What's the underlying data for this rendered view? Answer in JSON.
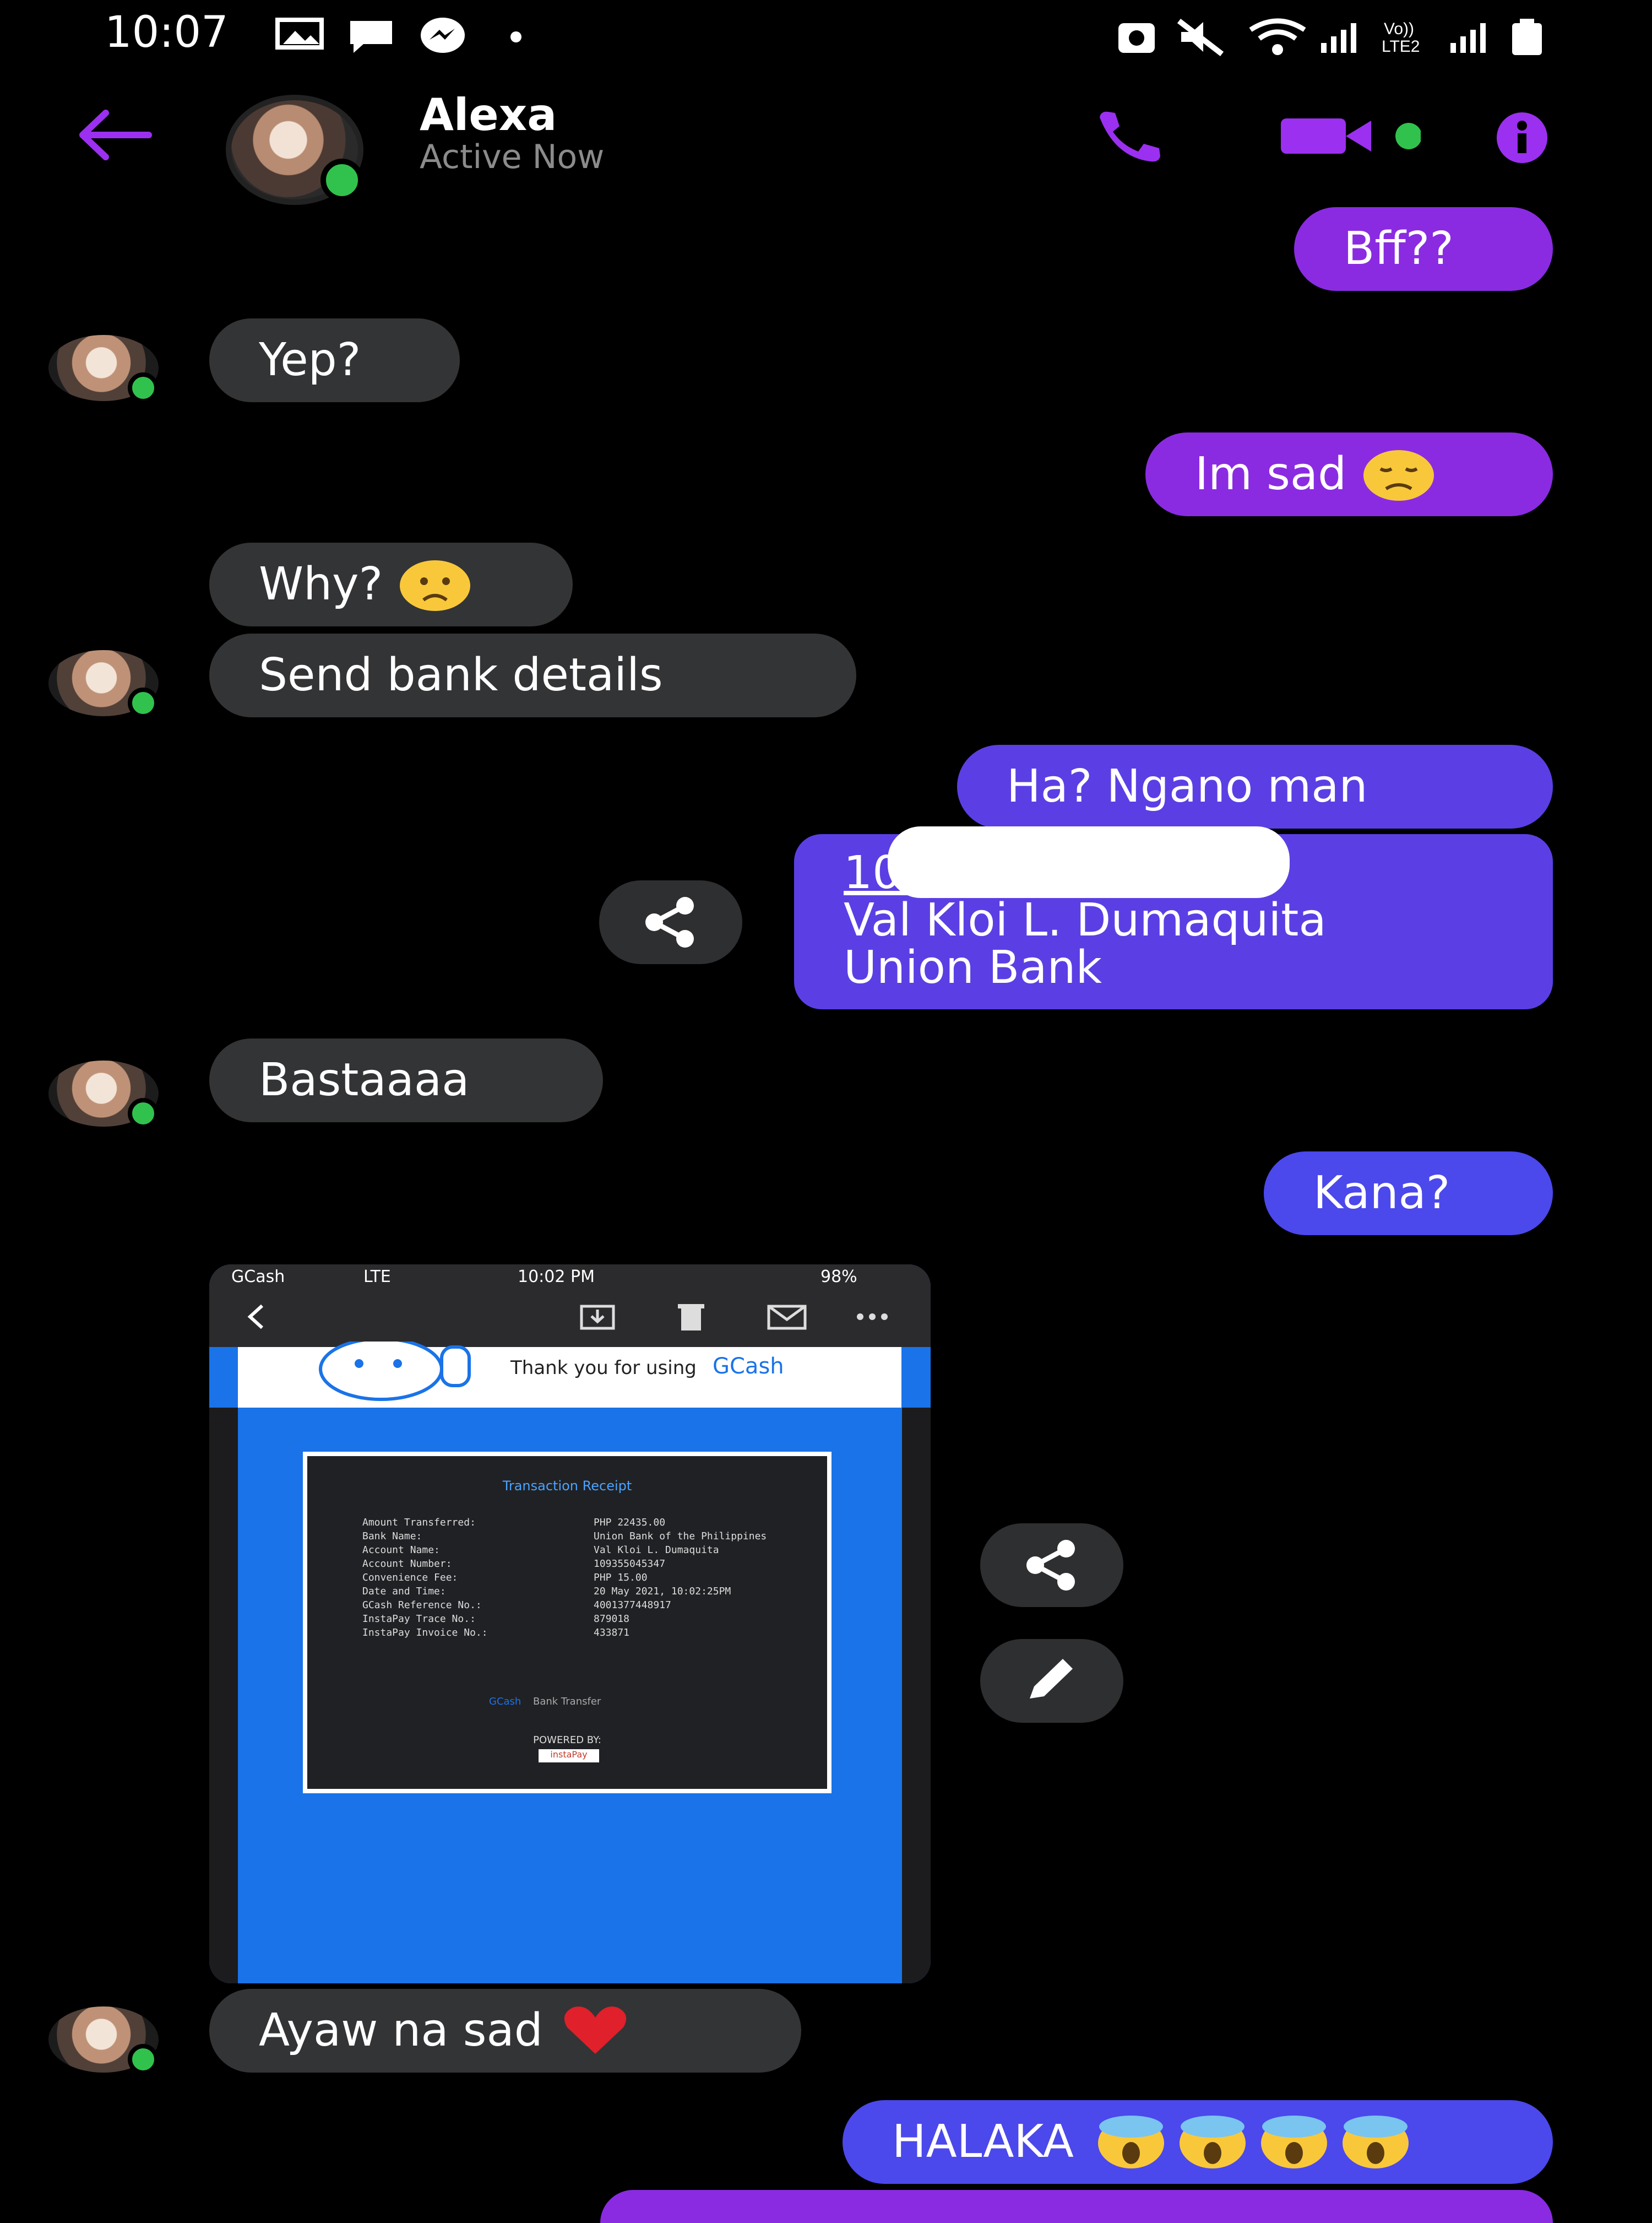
{
  "status_bar": {
    "time": "10:07"
  },
  "header": {
    "contact_name": "Alexa",
    "presence": "Active Now"
  },
  "messages": {
    "m1": "Bff??",
    "m2": "Yep?",
    "m3": "Im sad",
    "m4": "Why?",
    "m5": "Send bank details",
    "m6": "Ha? Ngano man",
    "m7_line1": "10          7",
    "m7_line2": "Val Kloi L. Dumaquita",
    "m7_line3": "Union Bank",
    "m8": "Bastaaaa",
    "m9": "Kana?",
    "m10": "Ayaw na sad",
    "m11": "HALAKA"
  },
  "receipt_image": {
    "status_left": "GCash",
    "status_network": "LTE",
    "status_time": "10:02 PM",
    "status_battery": "98%",
    "thank_text": "Thank you for using",
    "brand": "GCash",
    "title": "Transaction Receipt",
    "rows": [
      {
        "label": "Amount Transferred:",
        "value": "PHP 22435.00"
      },
      {
        "label": "Bank Name:",
        "value": "Union Bank of the Philippines"
      },
      {
        "label": "Account Name:",
        "value": "Val Kloi L. Dumaquita"
      },
      {
        "label": "Account Number:",
        "value": "109355045347"
      },
      {
        "label": "Convenience Fee:",
        "value": "PHP 15.00"
      },
      {
        "label": "Date and Time:",
        "value": "20 May 2021, 10:02:25PM"
      },
      {
        "label": "GCash Reference No.:",
        "value": "4001377448917"
      },
      {
        "label": "InstaPay Trace No.:",
        "value": "879018"
      },
      {
        "label": "InstaPay Invoice No.:",
        "value": "433871"
      }
    ],
    "footer_brand": "GCash",
    "footer_label": "Bank Transfer",
    "powered_by": "POWERED BY:",
    "powered_brand": "instaPay"
  },
  "colors": {
    "accent": "#8a2be2",
    "bubble_them": "#333436",
    "online": "#31c24d"
  }
}
